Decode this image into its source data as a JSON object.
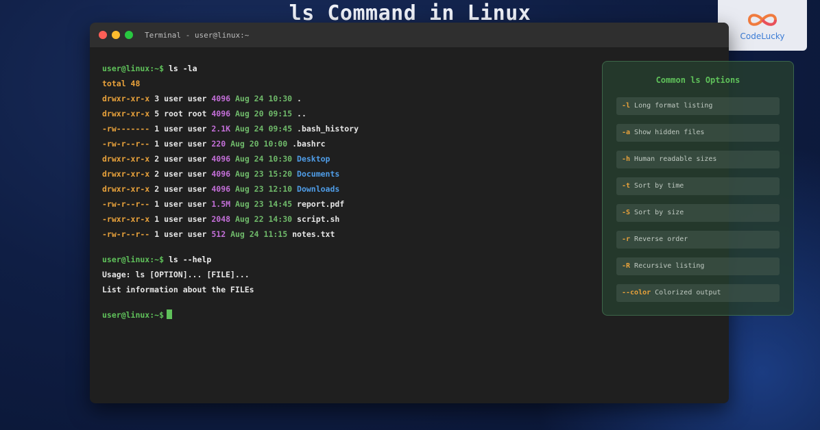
{
  "page": {
    "title": "ls Command in Linux"
  },
  "logo": {
    "text": "CodeLucky"
  },
  "terminal": {
    "title": "Terminal - user@linux:~",
    "prompt": "user@linux:~$",
    "command1": "ls -la",
    "total": "total 48",
    "rows": [
      {
        "perm": "drwxr-xr-x",
        "links": "3",
        "owner": "user",
        "group": "user",
        "size": "4096",
        "date": "Aug 24 10:30",
        "name": ".",
        "kind": "file"
      },
      {
        "perm": "drwxr-xr-x",
        "links": "5",
        "owner": "root",
        "group": "root",
        "size": "4096",
        "date": "Aug 20 09:15",
        "name": "..",
        "kind": "file"
      },
      {
        "perm": "-rw-------",
        "links": "1",
        "owner": "user",
        "group": "user",
        "size": "2.1K",
        "date": "Aug 24 09:45",
        "name": ".bash_history",
        "kind": "file"
      },
      {
        "perm": "-rw-r--r--",
        "links": "1",
        "owner": "user",
        "group": "user",
        "size": "220",
        "date": "Aug 20 10:00",
        "name": ".bashrc",
        "kind": "file"
      },
      {
        "perm": "drwxr-xr-x",
        "links": "2",
        "owner": "user",
        "group": "user",
        "size": "4096",
        "date": "Aug 24 10:30",
        "name": "Desktop",
        "kind": "dir"
      },
      {
        "perm": "drwxr-xr-x",
        "links": "2",
        "owner": "user",
        "group": "user",
        "size": "4096",
        "date": "Aug 23 15:20",
        "name": "Documents",
        "kind": "dir"
      },
      {
        "perm": "drwxr-xr-x",
        "links": "2",
        "owner": "user",
        "group": "user",
        "size": "4096",
        "date": "Aug 23 12:10",
        "name": "Downloads",
        "kind": "dir"
      },
      {
        "perm": "-rw-r--r--",
        "links": "1",
        "owner": "user",
        "group": "user",
        "size": "1.5M",
        "date": "Aug 23 14:45",
        "name": "report.pdf",
        "kind": "file"
      },
      {
        "perm": "-rwxr-xr-x",
        "links": "1",
        "owner": "user",
        "group": "user",
        "size": "2048",
        "date": "Aug 22 14:30",
        "name": "script.sh",
        "kind": "file"
      },
      {
        "perm": "-rw-r--r--",
        "links": "1",
        "owner": "user",
        "group": "user",
        "size": "512",
        "date": "Aug 24 11:15",
        "name": "notes.txt",
        "kind": "file"
      }
    ],
    "command2": "ls --help",
    "help_line1": "Usage: ls [OPTION]... [FILE]...",
    "help_line2": "List information about the FILEs"
  },
  "options": {
    "title": "Common ls Options",
    "items": [
      {
        "flag": "-l",
        "desc": "Long format listing"
      },
      {
        "flag": "-a",
        "desc": "Show hidden files"
      },
      {
        "flag": "-h",
        "desc": "Human readable sizes"
      },
      {
        "flag": "-t",
        "desc": "Sort by time"
      },
      {
        "flag": "-S",
        "desc": "Sort by size"
      },
      {
        "flag": "-r",
        "desc": "Reverse order"
      },
      {
        "flag": "-R",
        "desc": "Recursive listing"
      },
      {
        "flag": "--color",
        "desc": "Colorized output"
      }
    ]
  },
  "colors": {
    "prompt": "#5fc15a",
    "permissions": "#e9a23b",
    "size": "#c36fd8",
    "date": "#6fb96a",
    "directory": "#4f9de8",
    "panel_background": "#263e2e"
  }
}
